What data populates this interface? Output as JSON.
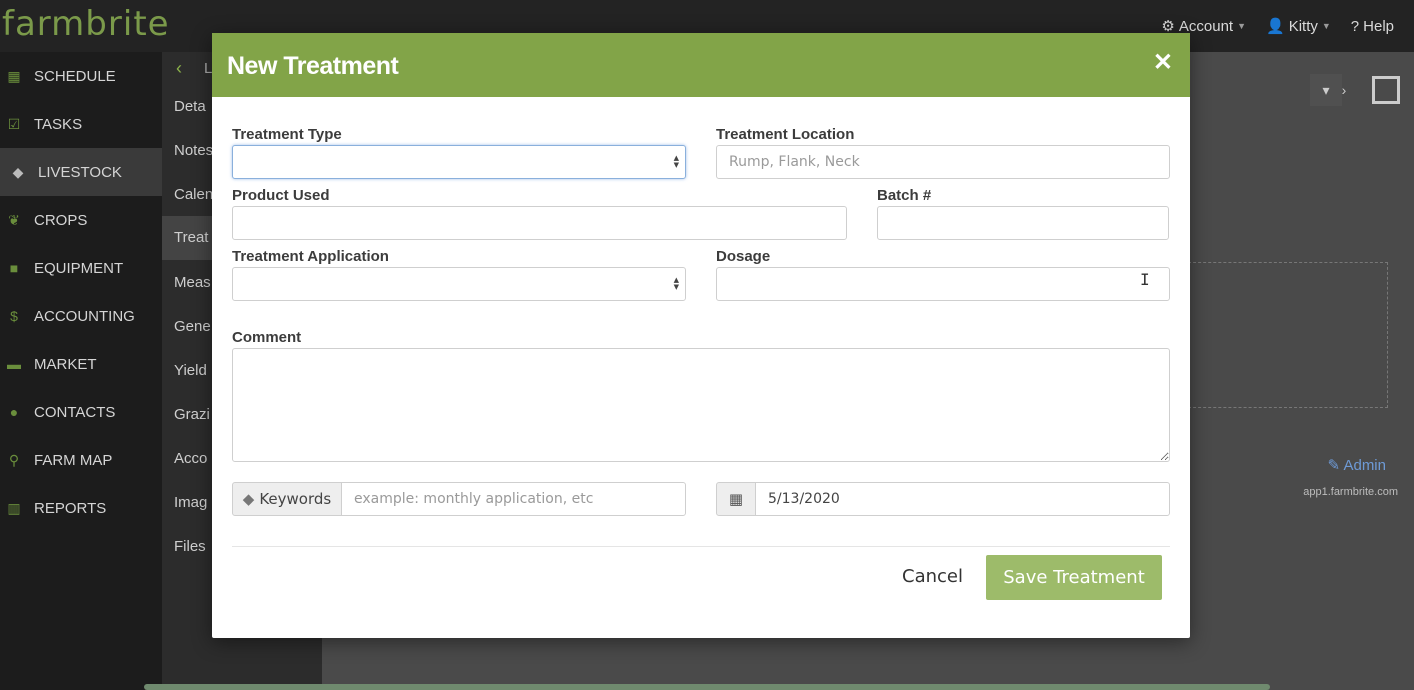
{
  "app": {
    "logo": "farmbrite"
  },
  "topnav": {
    "account": "Account",
    "user": "Kitty",
    "help": "Help"
  },
  "sidebar": {
    "items": [
      {
        "label": "SCHEDULE",
        "icon": "calendar-icon"
      },
      {
        "label": "TASKS",
        "icon": "checkbox-icon"
      },
      {
        "label": "LIVESTOCK",
        "icon": "tag-icon"
      },
      {
        "label": "CROPS",
        "icon": "leaf-icon"
      },
      {
        "label": "EQUIPMENT",
        "icon": "truck-icon"
      },
      {
        "label": "ACCOUNTING",
        "icon": "dollar-icon"
      },
      {
        "label": "MARKET",
        "icon": "cart-icon"
      },
      {
        "label": "CONTACTS",
        "icon": "users-icon"
      },
      {
        "label": "FARM MAP",
        "icon": "map-pin-icon"
      },
      {
        "label": "REPORTS",
        "icon": "bar-chart-icon"
      }
    ]
  },
  "subnav": {
    "back": "L",
    "items": [
      "Deta",
      "Notes",
      "Calen",
      "Treat",
      "Meas",
      "Gene",
      "Yield",
      "Grazi",
      "Acco",
      "Imag",
      "Files"
    ]
  },
  "content": {
    "admin_link": "Admin",
    "host": "app1.farmbrite.com"
  },
  "modal": {
    "title": "New Treatment",
    "fields": {
      "treatment_type": {
        "label": "Treatment Type",
        "value": ""
      },
      "treatment_location": {
        "label": "Treatment Location",
        "placeholder": "Rump, Flank, Neck"
      },
      "product_used": {
        "label": "Product Used",
        "value": ""
      },
      "batch": {
        "label": "Batch #",
        "value": ""
      },
      "treatment_application": {
        "label": "Treatment Application",
        "value": ""
      },
      "dosage": {
        "label": "Dosage",
        "value": ""
      },
      "comment": {
        "label": "Comment",
        "value": ""
      },
      "keywords": {
        "addon_label": "Keywords",
        "placeholder": "example: monthly application, etc"
      },
      "date": {
        "value": "5/13/2020"
      }
    },
    "buttons": {
      "cancel": "Cancel",
      "save": "Save Treatment"
    }
  },
  "colors": {
    "brand_green": "#82a448",
    "save_button": "#9dbb6a"
  }
}
